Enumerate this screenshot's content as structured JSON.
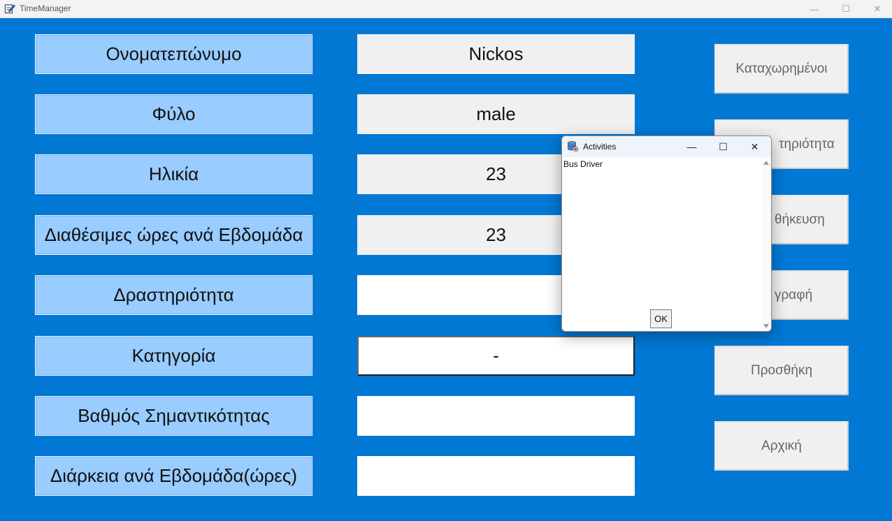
{
  "window": {
    "title": "TimeManager",
    "icon": "notepad-pen-icon",
    "controls": {
      "minimize": "—",
      "maximize": "☐",
      "close": "✕"
    }
  },
  "form": {
    "labels": [
      "Ονοματεπώνυμο",
      "Φύλο",
      "Ηλικία",
      "Διαθέσιμες ώρες ανά Εβδομάδα",
      "Δραστηριότητα",
      "Κατηγορία",
      "Βαθμός Σημαντικότητας",
      "Διάρκεια ανά Εβδομάδα(ώρες)"
    ],
    "values": {
      "name": "Nickos",
      "gender": "male",
      "age": "23",
      "available_hours": "23",
      "activity": "",
      "category": "-",
      "importance": "",
      "duration": ""
    }
  },
  "buttons": {
    "registered": "Καταχωρημένοι",
    "activity": "τηριότητα",
    "save": "θήκευση",
    "delete": "γραφή",
    "add": "Προσθήκη",
    "home": "Αρχική"
  },
  "dialog": {
    "title": "Activities",
    "icon": "database-icon",
    "items": [
      "Bus Driver"
    ],
    "ok_label": "OK",
    "controls": {
      "minimize": "—",
      "maximize": "☐",
      "close": "✕"
    }
  },
  "colors": {
    "background": "#0078d4",
    "label_fill": "#99ccff",
    "field_fill": "#f0f0f0"
  }
}
